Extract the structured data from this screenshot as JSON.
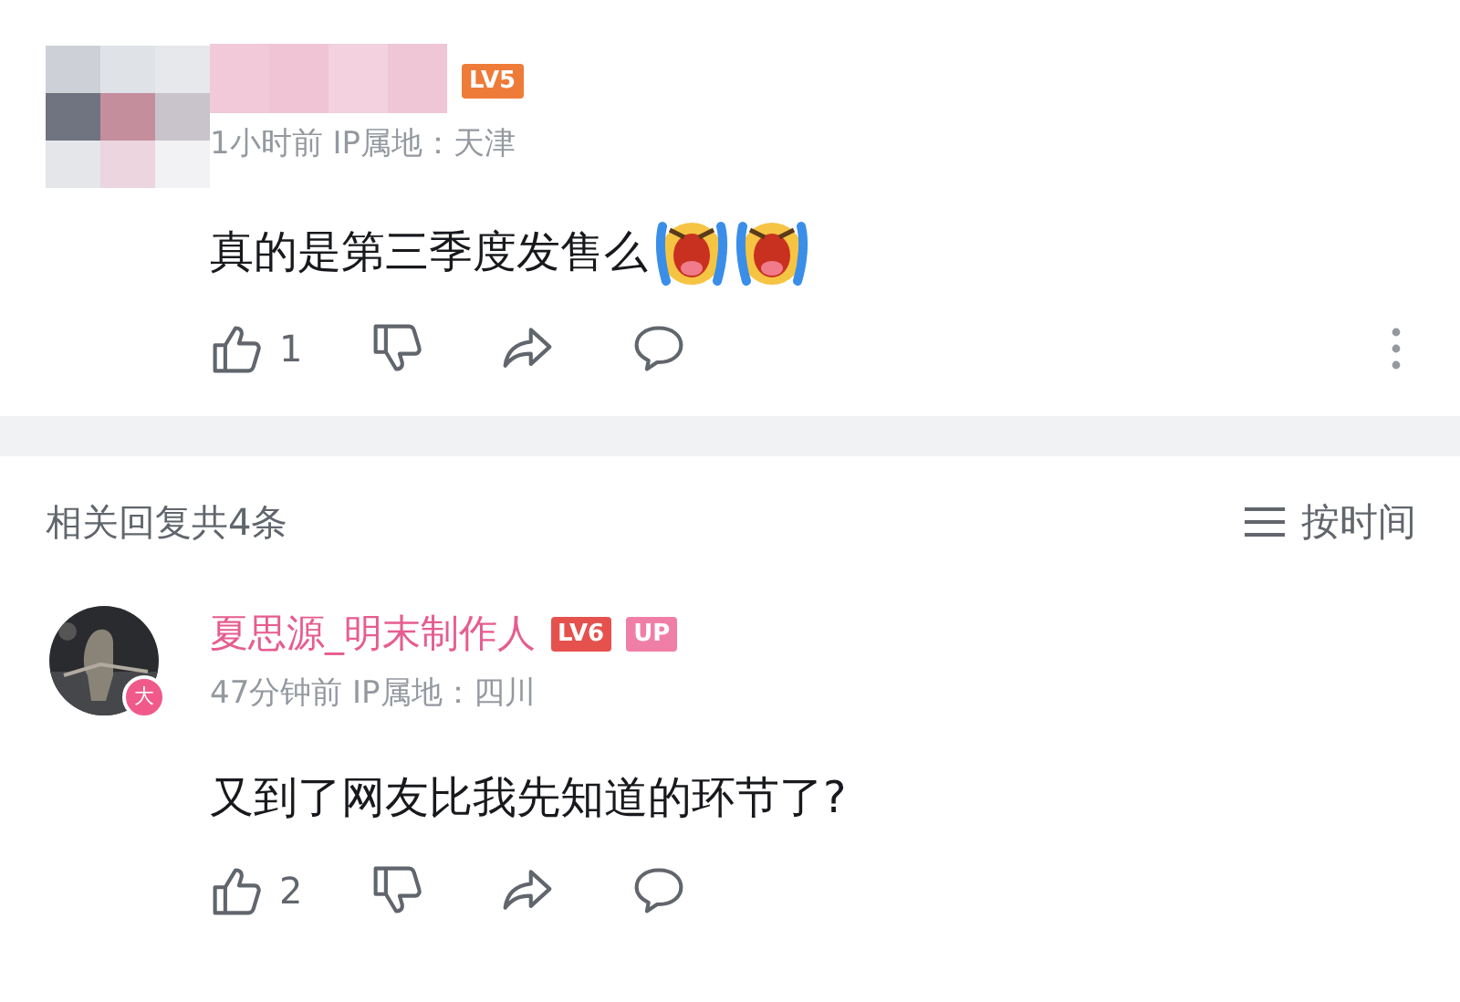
{
  "comments": [
    {
      "author": {
        "kind": "redacted"
      },
      "level_badge": {
        "text": "LV5",
        "color": "#ee7b38"
      },
      "meta": "1小时前 IP属地：天津",
      "content": "真的是第三季度发售么",
      "emoji": [
        {
          "kind": "crying"
        },
        {
          "kind": "crying"
        }
      ],
      "like_count": "1",
      "more": true
    },
    {
      "author": {
        "kind": "user",
        "name": "夏思源_明末制作人",
        "badge": "大"
      },
      "level_badge": {
        "text": "LV6",
        "color": "#e5524e"
      },
      "up_badge": "UP",
      "meta": "47分钟前 IP属地：四川",
      "content": "又到了网友比我先知道的环节了?",
      "like_count": "2"
    }
  ],
  "replies_header": {
    "count_label": "相关回复共4条",
    "sort_label": "按时间"
  }
}
